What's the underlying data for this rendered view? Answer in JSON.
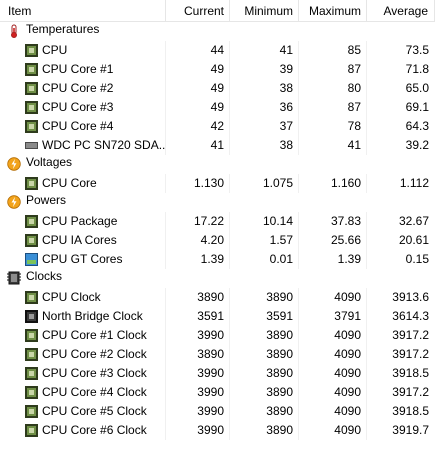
{
  "columns": {
    "item": "Item",
    "current": "Current",
    "minimum": "Minimum",
    "maximum": "Maximum",
    "average": "Average"
  },
  "groups": [
    {
      "label": "Temperatures",
      "icon": "thermometer-icon",
      "rows": [
        {
          "name": "CPU",
          "icon": "cpu-chip-icon",
          "current": "44",
          "minimum": "41",
          "maximum": "85",
          "average": "73.5"
        },
        {
          "name": "CPU Core #1",
          "icon": "cpu-chip-icon",
          "current": "49",
          "minimum": "39",
          "maximum": "87",
          "average": "71.8"
        },
        {
          "name": "CPU Core #2",
          "icon": "cpu-chip-icon",
          "current": "49",
          "minimum": "38",
          "maximum": "80",
          "average": "65.0"
        },
        {
          "name": "CPU Core #3",
          "icon": "cpu-chip-icon",
          "current": "49",
          "minimum": "36",
          "maximum": "87",
          "average": "69.1"
        },
        {
          "name": "CPU Core #4",
          "icon": "cpu-chip-icon",
          "current": "42",
          "minimum": "37",
          "maximum": "78",
          "average": "64.3"
        },
        {
          "name": "WDC PC SN720 SDA...",
          "icon": "drive-icon",
          "current": "41",
          "minimum": "38",
          "maximum": "41",
          "average": "39.2"
        }
      ]
    },
    {
      "label": "Voltages",
      "icon": "lightning-icon",
      "rows": [
        {
          "name": "CPU Core",
          "icon": "cpu-chip-icon",
          "current": "1.130",
          "minimum": "1.075",
          "maximum": "1.160",
          "average": "1.112"
        }
      ]
    },
    {
      "label": "Powers",
      "icon": "lightning-icon",
      "rows": [
        {
          "name": "CPU Package",
          "icon": "cpu-chip-icon",
          "current": "17.22",
          "minimum": "10.14",
          "maximum": "37.83",
          "average": "32.67"
        },
        {
          "name": "CPU IA Cores",
          "icon": "cpu-chip-icon",
          "current": "4.20",
          "minimum": "1.57",
          "maximum": "25.66",
          "average": "20.61"
        },
        {
          "name": "CPU GT Cores",
          "icon": "monitor-icon",
          "current": "1.39",
          "minimum": "0.01",
          "maximum": "1.39",
          "average": "0.15"
        }
      ]
    },
    {
      "label": "Clocks",
      "icon": "clock-chip-icon",
      "rows": [
        {
          "name": "CPU Clock",
          "icon": "cpu-chip-icon",
          "current": "3890",
          "minimum": "3890",
          "maximum": "4090",
          "average": "3913.6"
        },
        {
          "name": "North Bridge Clock",
          "icon": "chipset-icon",
          "current": "3591",
          "minimum": "3591",
          "maximum": "3791",
          "average": "3614.3"
        },
        {
          "name": "CPU Core #1 Clock",
          "icon": "cpu-chip-icon",
          "current": "3990",
          "minimum": "3890",
          "maximum": "4090",
          "average": "3917.2"
        },
        {
          "name": "CPU Core #2 Clock",
          "icon": "cpu-chip-icon",
          "current": "3890",
          "minimum": "3890",
          "maximum": "4090",
          "average": "3917.2"
        },
        {
          "name": "CPU Core #3 Clock",
          "icon": "cpu-chip-icon",
          "current": "3990",
          "minimum": "3890",
          "maximum": "4090",
          "average": "3918.5"
        },
        {
          "name": "CPU Core #4 Clock",
          "icon": "cpu-chip-icon",
          "current": "3990",
          "minimum": "3890",
          "maximum": "4090",
          "average": "3917.2"
        },
        {
          "name": "CPU Core #5 Clock",
          "icon": "cpu-chip-icon",
          "current": "3990",
          "minimum": "3890",
          "maximum": "4090",
          "average": "3918.5"
        },
        {
          "name": "CPU Core #6 Clock",
          "icon": "cpu-chip-icon",
          "current": "3990",
          "minimum": "3890",
          "maximum": "4090",
          "average": "3919.7"
        }
      ]
    }
  ]
}
